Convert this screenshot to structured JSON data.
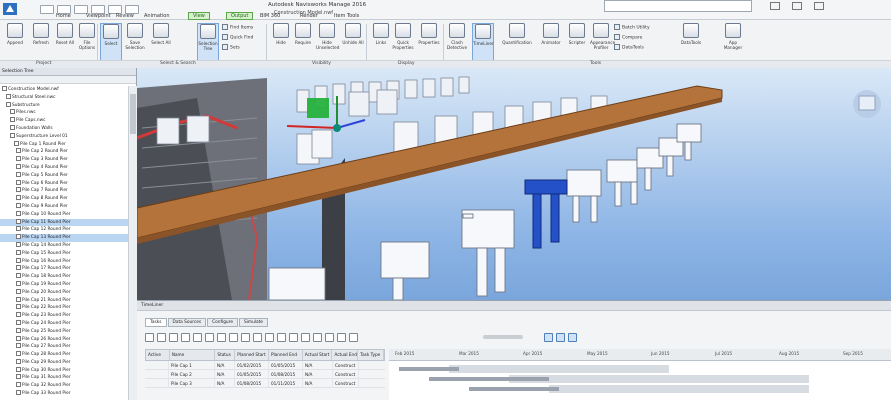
{
  "window": {
    "title": "Autodesk Navisworks Manage 2016",
    "subtitle": "Construction Model.nwf",
    "help_placeholder": "Type a keyword or phrase"
  },
  "ribbon_tabs": [
    "Home",
    "Viewpoint",
    "Review",
    "Animation",
    "View",
    "Output",
    "BIM 360",
    "Render",
    "Item Tools"
  ],
  "ribbon_panels": {
    "project": "Project",
    "select_search": "Select & Search",
    "visibility": "Visibility",
    "display": "Display",
    "tools": "Tools"
  },
  "ribbon_buttons": [
    "Append",
    "Refresh",
    "Reset All",
    "File Options",
    "Select",
    "Save Selection",
    "Select All",
    "Selection Tree",
    "Hide",
    "Require",
    "Hide Unselected",
    "Unhide All",
    "Links",
    "Quick Properties",
    "Properties",
    "Clash Detective",
    "TimeLiner",
    "Quantification",
    "Animator",
    "Scripter",
    "Appearance Profiler",
    "DataTools",
    "App Manager"
  ],
  "ribbon_small": [
    "Find Items",
    "Quick Find",
    "Sets",
    "Batch Utility",
    "Compare",
    "DataTools"
  ],
  "tree": {
    "header": "Selection Tree",
    "rows": [
      "Construction Model.nwf",
      "Structural Steel.nwc",
      "Substructure",
      "Piles.nwc",
      "Pile Caps.nwc",
      "Foundation Walls",
      "Superstructure Level 01",
      "Pile Cap 1 Round Pier",
      "Pile Cap 2 Round Pier",
      "Pile Cap 3 Round Pier",
      "Pile Cap 4 Round Pier",
      "Pile Cap 5 Round Pier",
      "Pile Cap 6 Round Pier",
      "Pile Cap 7 Round Pier",
      "Pile Cap 8 Round Pier",
      "Pile Cap 9 Round Pier",
      "Pile Cap 10 Round Pier",
      "Pile Cap 11 Round Pier",
      "Pile Cap 12 Round Pier",
      "Pile Cap 13 Round Pier",
      "Pile Cap 14 Round Pier",
      "Pile Cap 15 Round Pier",
      "Pile Cap 16 Round Pier",
      "Pile Cap 17 Round Pier",
      "Pile Cap 18 Round Pier",
      "Pile Cap 19 Round Pier",
      "Pile Cap 20 Round Pier",
      "Pile Cap 21 Round Pier",
      "Pile Cap 22 Round Pier",
      "Pile Cap 23 Round Pier",
      "Pile Cap 24 Round Pier",
      "Pile Cap 25 Round Pier",
      "Pile Cap 26 Round Pier",
      "Pile Cap 27 Round Pier",
      "Pile Cap 28 Round Pier",
      "Pile Cap 29 Round Pier",
      "Pile Cap 30 Round Pier",
      "Pile Cap 31 Round Pier",
      "Pile Cap 32 Round Pier",
      "Pile Cap 33 Round Pier"
    ]
  },
  "timeliner": {
    "title": "TimeLiner",
    "tabs": [
      "Tasks",
      "Data Sources",
      "Configure",
      "Simulate"
    ],
    "columns": [
      "Active",
      "Name",
      "Status",
      "Planned Start",
      "Planned End",
      "Actual Start",
      "Actual End",
      "Task Type"
    ],
    "rows": [
      [
        "",
        "Pile Cap 1",
        "N/A",
        "01/02/2015",
        "01/05/2015",
        "N/A",
        "Construct"
      ],
      [
        "",
        "Pile Cap 2",
        "N/A",
        "01/05/2015",
        "01/08/2015",
        "N/A",
        "Construct"
      ],
      [
        "",
        "Pile Cap 3",
        "N/A",
        "01/08/2015",
        "01/11/2015",
        "N/A",
        "Construct"
      ]
    ],
    "gantt_dates": [
      "Feb 2015",
      "Mar 2015",
      "Apr 2015",
      "May 2015",
      "Jun 2015",
      "Jul 2015",
      "Aug 2015",
      "Sep 2015"
    ]
  },
  "colors": {
    "sky_top": "#d9e8f7",
    "sky_bottom": "#7aa6dc",
    "beam": "#b5733c",
    "highlight_pier": "#2450c8",
    "selection": "#b9d5f2"
  }
}
